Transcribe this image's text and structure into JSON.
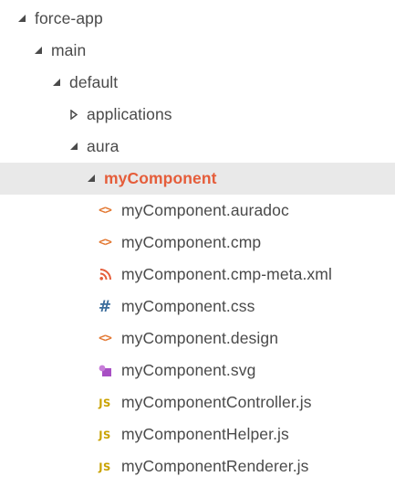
{
  "tree": [
    {
      "label": "force-app",
      "kind": "folder",
      "expanded": true,
      "depth": 0
    },
    {
      "label": "main",
      "kind": "folder",
      "expanded": true,
      "depth": 1
    },
    {
      "label": "default",
      "kind": "folder",
      "expanded": true,
      "depth": 2
    },
    {
      "label": "applications",
      "kind": "folder",
      "expanded": false,
      "depth": 3
    },
    {
      "label": "aura",
      "kind": "folder",
      "expanded": true,
      "depth": 3
    },
    {
      "label": "myComponent",
      "kind": "folder",
      "expanded": true,
      "depth": 4,
      "selected": true
    },
    {
      "label": "myComponent.auradoc",
      "kind": "file",
      "icon": "markup-icon",
      "depth": 5
    },
    {
      "label": "myComponent.cmp",
      "kind": "file",
      "icon": "markup-icon",
      "depth": 5
    },
    {
      "label": "myComponent.cmp-meta.xml",
      "kind": "file",
      "icon": "rss-xml-icon",
      "depth": 5
    },
    {
      "label": "myComponent.css",
      "kind": "file",
      "icon": "css-hash-icon",
      "depth": 5
    },
    {
      "label": "myComponent.design",
      "kind": "file",
      "icon": "markup-icon",
      "depth": 5
    },
    {
      "label": "myComponent.svg",
      "kind": "file",
      "icon": "svg-shape-icon",
      "depth": 5
    },
    {
      "label": "myComponentController.js",
      "kind": "file",
      "icon": "js-icon",
      "depth": 5
    },
    {
      "label": "myComponentHelper.js",
      "kind": "file",
      "icon": "js-icon",
      "depth": 5
    },
    {
      "label": "myComponentRenderer.js",
      "kind": "file",
      "icon": "js-icon",
      "depth": 5
    }
  ],
  "icon_text": {
    "markup": "<>",
    "css": "#",
    "js": "JS"
  },
  "colors": {
    "selected_background": "#e9e9e9",
    "selected_text": "#e55d3a",
    "text": "#4a4a4a",
    "chevron": "#4a4a4a",
    "markup_icon": "#e37933",
    "xml_icon": "#e55d3a",
    "css_icon": "#3b6d9c",
    "svg_icon": "#a84fc4",
    "js_icon": "#c9a200"
  }
}
